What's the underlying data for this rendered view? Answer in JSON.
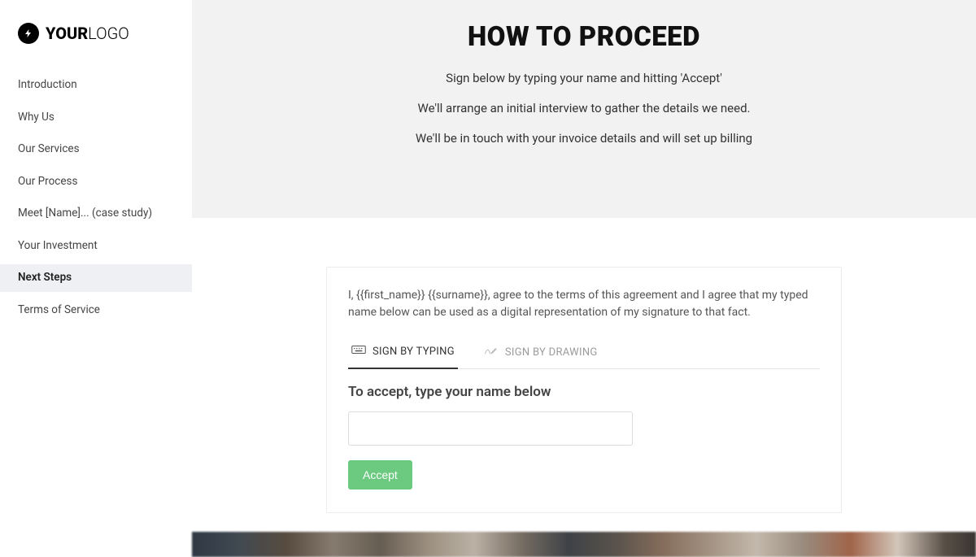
{
  "logo": {
    "bold": "YOUR",
    "light": "LOGO"
  },
  "sidebar": {
    "items": [
      {
        "label": "Introduction",
        "active": false
      },
      {
        "label": "Why Us",
        "active": false
      },
      {
        "label": "Our Services",
        "active": false
      },
      {
        "label": "Our Process",
        "active": false
      },
      {
        "label": "Meet [Name]... (case study)",
        "active": false
      },
      {
        "label": "Your Investment",
        "active": false
      },
      {
        "label": "Next Steps",
        "active": true
      },
      {
        "label": "Terms of Service",
        "active": false
      }
    ]
  },
  "hero": {
    "title": "HOW TO PROCEED",
    "lines": [
      "Sign below by typing your name and hitting 'Accept'",
      "We'll arrange an initial interview to gather the details we need.",
      "We'll be in touch with your invoice details and will set up billing"
    ]
  },
  "card": {
    "agreement_text": "I, {{first_name}} {{surname}}, agree to the terms of this agreement and I agree that my typed name below can be used as a digital representation of my signature to that fact.",
    "tabs": {
      "typing": "SIGN BY TYPING",
      "drawing": "SIGN BY DRAWING"
    },
    "prompt": "To accept, type your name below",
    "input_value": "",
    "accept_label": "Accept"
  }
}
